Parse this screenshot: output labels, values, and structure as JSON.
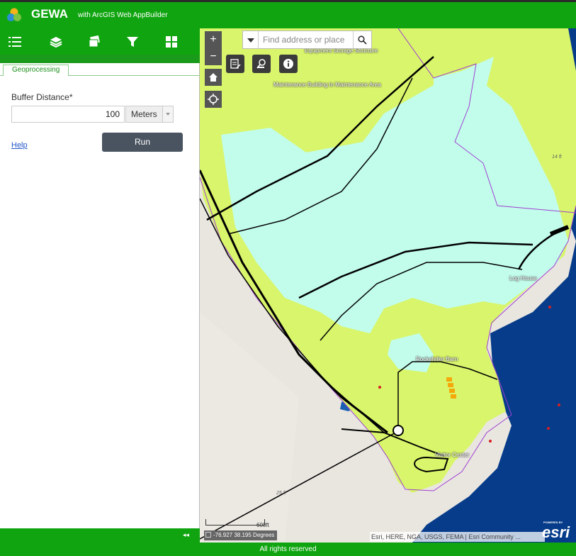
{
  "header": {
    "title": "GEWA",
    "subtitle": "with ArcGIS Web AppBuilder"
  },
  "toolbar": {
    "icons": [
      "legend-icon",
      "layers-icon",
      "basemap-gallery-icon",
      "filter-icon",
      "widgets-icon"
    ]
  },
  "panel": {
    "tab_label": "Geoprocessing",
    "buffer_label": "Buffer Distance*",
    "buffer_value": "100",
    "unit_value": "Meters",
    "help_label": "Help",
    "run_label": "Run",
    "collapse_label": "◂◂"
  },
  "map": {
    "search_placeholder": "Find address or place",
    "zoom_in": "+",
    "zoom_out": "−",
    "labels": {
      "equipment": "Equipment Storage Structure",
      "maintenance": "Maintenance Building in Maintenance Area",
      "log_house": "Log House",
      "barn": "Rockefeller Barn",
      "visitor": "Visitor Center"
    },
    "elevation_labels": [
      "14 ft",
      "25 ft"
    ],
    "scale_label": "600ft",
    "coordinates": "-76.927 38.195 Degrees",
    "attribution": "Esri, HERE, NGA, USGS, FEMA | Esri Community ...",
    "esri_powered": "POWERED BY",
    "esri_word": "esri"
  },
  "footer": {
    "rights": "All rights reserved"
  },
  "colors": {
    "brand_green": "#10a510",
    "map_lime": "#d8f56b",
    "map_aqua": "#c2fdec",
    "water": "#063c8a"
  }
}
